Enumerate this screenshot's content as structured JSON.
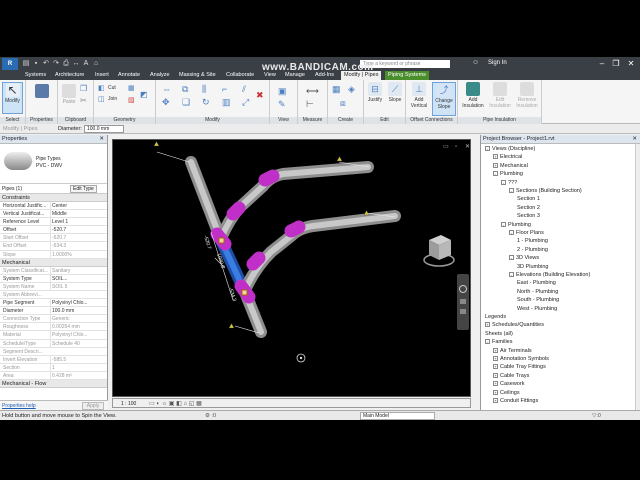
{
  "window": {
    "project_name": "Project1.rvt",
    "search_placeholder": "Type a keyword or phrase",
    "sign_in": "Sign In",
    "logo": "R"
  },
  "watermark": {
    "text": "www.BANDICAM.com"
  },
  "tabs": [
    "Systems",
    "Architecture",
    "Insert",
    "Annotate",
    "Analyze",
    "Massing & Site",
    "Collaborate",
    "View",
    "Manage",
    "Add-Ins",
    "Modify | Pipes",
    "Piping Systems"
  ],
  "ribbon": {
    "panels": [
      {
        "title": "Select",
        "buttons": [
          "Modify"
        ]
      },
      {
        "title": "Properties",
        "buttons": []
      },
      {
        "title": "Clipboard",
        "buttons": [
          "Paste"
        ]
      },
      {
        "title": "Geometry",
        "buttons": [
          "Cut",
          "Join"
        ]
      },
      {
        "title": "Modify",
        "buttons": []
      },
      {
        "title": "View",
        "buttons": []
      },
      {
        "title": "Measure",
        "buttons": []
      },
      {
        "title": "Create",
        "buttons": []
      },
      {
        "title": "Edit",
        "buttons": [
          "Justify",
          "Slope"
        ]
      },
      {
        "title": "Offset Connections",
        "buttons": [
          "Add Vertical",
          "Change Slope"
        ]
      },
      {
        "title": "Pipe Insulation",
        "buttons": [
          "Add Insulation",
          "Edit Insulation",
          "Remove Insulation"
        ]
      }
    ]
  },
  "options_bar": {
    "context": "Modify | Pipes",
    "diameter_label": "Diameter:",
    "diameter_value": "100.0 mm"
  },
  "properties": {
    "title": "Properties",
    "type_family": "Pipe Types",
    "type_name": "PVC - DWV",
    "instance_selector": "Pipes (1)",
    "edit_type": "Edit Type",
    "sections": [
      {
        "name": "Constraints",
        "rows": [
          {
            "k": "Horizontal Justific...",
            "v": "Center",
            "dim": false
          },
          {
            "k": "Vertical Justificat...",
            "v": "Middle",
            "dim": false
          },
          {
            "k": "Reference Level",
            "v": "Level 1",
            "dim": false
          },
          {
            "k": "Offset",
            "v": "-520.7",
            "dim": false
          },
          {
            "k": "Start Offset",
            "v": "-520.7",
            "dim": true
          },
          {
            "k": "End Offset",
            "v": "-534.3",
            "dim": true
          },
          {
            "k": "Slope",
            "v": "1.0000%",
            "dim": true
          }
        ]
      },
      {
        "name": "Mechanical",
        "rows": [
          {
            "k": "System Classificat...",
            "v": "Sanitary",
            "dim": true
          },
          {
            "k": "System Type",
            "v": "SOIL...",
            "dim": false
          },
          {
            "k": "System Name",
            "v": "SOIL 5",
            "dim": true
          },
          {
            "k": "System Abbrevi...",
            "v": "",
            "dim": true
          },
          {
            "k": "Pipe Segment",
            "v": "Polyvinyl Chlo...",
            "dim": false
          },
          {
            "k": "Diameter",
            "v": "100.0 mm",
            "dim": false
          },
          {
            "k": "Connection Type",
            "v": "Generic",
            "dim": true
          },
          {
            "k": "Roughness",
            "v": "0.00254 mm",
            "dim": true
          },
          {
            "k": "Material",
            "v": "Polyvinyl Chlo...",
            "dim": true
          },
          {
            "k": "Schedule/Type",
            "v": "Schedule 40",
            "dim": true
          },
          {
            "k": "Segment Descri...",
            "v": "",
            "dim": true
          },
          {
            "k": "Invert Elevation",
            "v": "-585.5",
            "dim": true
          },
          {
            "k": "Section",
            "v": "1",
            "dim": true
          },
          {
            "k": "Area",
            "v": "0.428 m²",
            "dim": true
          }
        ]
      },
      {
        "name": "Mechanical - Flow",
        "rows": []
      }
    ],
    "help": "Properties help",
    "apply": "Apply"
  },
  "viewport": {
    "scale": "1 : 100",
    "dims": [
      "-520.7",
      "1000.0",
      "-534.3"
    ]
  },
  "browser": {
    "title": "Project Browser - Project1.rvt",
    "items": [
      {
        "label": "Views (Discipline)",
        "level": 0,
        "tog": "-"
      },
      {
        "label": "Electrical",
        "level": 1,
        "tog": "+"
      },
      {
        "label": "Mechanical",
        "level": 1,
        "tog": "+"
      },
      {
        "label": "Plumbing",
        "level": 1,
        "tog": "-"
      },
      {
        "label": "???",
        "level": 2,
        "tog": "-"
      },
      {
        "label": "Sections (Building Section)",
        "level": 3,
        "tog": "-"
      },
      {
        "label": "Section 1",
        "level": 4,
        "tog": ""
      },
      {
        "label": "Section 2",
        "level": 4,
        "tog": ""
      },
      {
        "label": "Section 3",
        "level": 4,
        "tog": ""
      },
      {
        "label": "Plumbing",
        "level": 2,
        "tog": "-"
      },
      {
        "label": "Floor Plans",
        "level": 3,
        "tog": "-"
      },
      {
        "label": "1 - Plumbing",
        "level": 4,
        "tog": ""
      },
      {
        "label": "2 - Plumbing",
        "level": 4,
        "tog": ""
      },
      {
        "label": "3D Views",
        "level": 3,
        "tog": "-"
      },
      {
        "label": "3D Plumbing",
        "level": 4,
        "tog": ""
      },
      {
        "label": "Elevations (Building Elevation)",
        "level": 3,
        "tog": "-"
      },
      {
        "label": "East - Plumbing",
        "level": 4,
        "tog": ""
      },
      {
        "label": "North - Plumbing",
        "level": 4,
        "tog": ""
      },
      {
        "label": "South - Plumbing",
        "level": 4,
        "tog": ""
      },
      {
        "label": "West - Plumbing",
        "level": 4,
        "tog": ""
      },
      {
        "label": "Legends",
        "level": 0,
        "tog": ""
      },
      {
        "label": "Schedules/Quantities",
        "level": 0,
        "tog": "+"
      },
      {
        "label": "Sheets (all)",
        "level": 0,
        "tog": ""
      },
      {
        "label": "Families",
        "level": 0,
        "tog": "-"
      },
      {
        "label": "Air Terminals",
        "level": 1,
        "tog": "+"
      },
      {
        "label": "Annotation Symbols",
        "level": 1,
        "tog": "+"
      },
      {
        "label": "Cable Tray Fittings",
        "level": 1,
        "tog": "+"
      },
      {
        "label": "Cable Trays",
        "level": 1,
        "tog": "+"
      },
      {
        "label": "Casework",
        "level": 1,
        "tog": "+"
      },
      {
        "label": "Ceilings",
        "level": 1,
        "tog": "+"
      },
      {
        "label": "Conduit Fittings",
        "level": 1,
        "tog": "+"
      }
    ]
  },
  "status": {
    "message": "Hold button and move mouse to Spin the View.",
    "main_model": "Main Model"
  },
  "colors": {
    "ribbon_context": "#4a8f2c",
    "selected_pipe": "#2f6fd6",
    "pipe": "#b9b9b9",
    "fitting": "#c030c8",
    "titlebar": "#3a3f46"
  }
}
